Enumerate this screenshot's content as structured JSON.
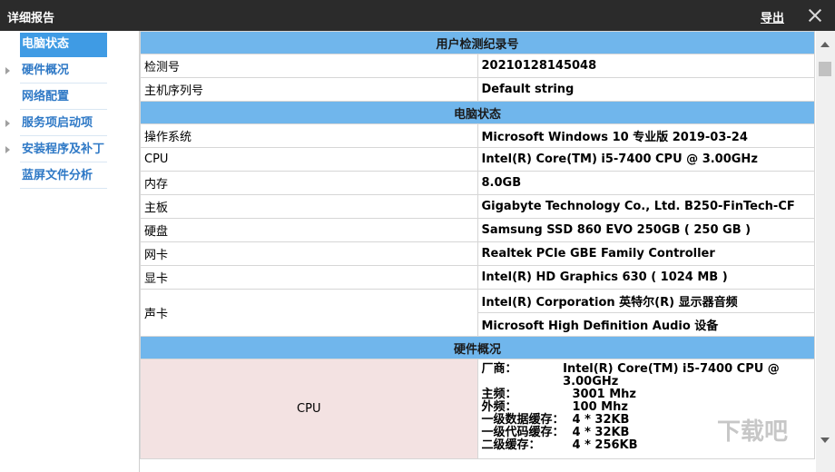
{
  "window": {
    "title": "详细报告",
    "export_label": "导出"
  },
  "sidebar": {
    "items": [
      {
        "label": "电脑状态"
      },
      {
        "label": "硬件概况"
      },
      {
        "label": "网络配置"
      },
      {
        "label": "服务项启动项"
      },
      {
        "label": "安装程序及补丁"
      },
      {
        "label": "蓝屏文件分析"
      }
    ]
  },
  "sections": {
    "record": {
      "header": "用户检测纪录号",
      "rows": [
        {
          "k": "检测号",
          "v": "20210128145048"
        },
        {
          "k": "主机序列号",
          "v": "Default string"
        }
      ]
    },
    "status": {
      "header": "电脑状态",
      "rows": [
        {
          "k": "操作系统",
          "v": "Microsoft Windows 10 专业版 2019-03-24"
        },
        {
          "k": "CPU",
          "v": "Intel(R) Core(TM) i5-7400 CPU @ 3.00GHz"
        },
        {
          "k": "内存",
          "v": "8.0GB"
        },
        {
          "k": "主板",
          "v": "Gigabyte Technology Co., Ltd. B250-FinTech-CF"
        },
        {
          "k": "硬盘",
          "v": "Samsung SSD 860 EVO 250GB ( 250 GB )"
        },
        {
          "k": "网卡",
          "v": "Realtek PCIe GBE Family Controller"
        },
        {
          "k": "显卡",
          "v": "Intel(R) HD Graphics 630 ( 1024 MB )"
        }
      ],
      "sound": {
        "k": "声卡",
        "v1": "Intel(R) Corporation 英特尔(R) 显示器音频",
        "v2": "Microsoft High Definition Audio 设备"
      }
    },
    "hardware": {
      "header": "硬件概况",
      "cpu_label": "CPU",
      "details": [
        {
          "k": "厂商：",
          "v": "Intel(R) Core(TM) i5-7400 CPU @ 3.00GHz"
        },
        {
          "k": "主频：",
          "v": "3001 Mhz"
        },
        {
          "k": "外频：",
          "v": "100 Mhz"
        },
        {
          "k": "一级数据缓存：",
          "v": "4 * 32KB"
        },
        {
          "k": "一级代码缓存：",
          "v": " 4 * 32KB"
        },
        {
          "k": "二级缓存：",
          "v": "4 * 256KB"
        }
      ]
    }
  },
  "watermark": "下载吧"
}
